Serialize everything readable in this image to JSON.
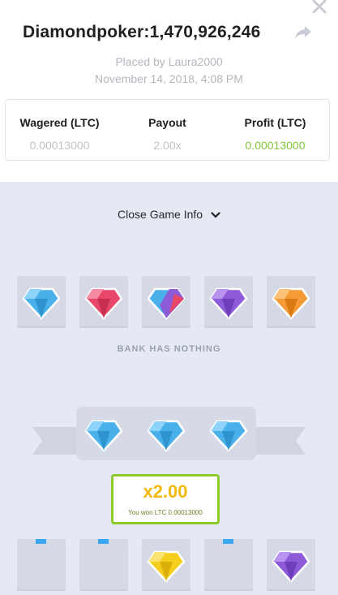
{
  "header": {
    "title": "Diamondpoker:1,470,926,246",
    "placed_by": "Placed by Laura2000",
    "placed_at": "November 14, 2018, 4:08 PM",
    "icons": [
      "close-icon",
      "share-icon"
    ]
  },
  "stats": {
    "wagered_label": "Wagered (LTC)",
    "wagered_value": "0.00013000",
    "payout_label": "Payout",
    "payout_value": "2.00x",
    "profit_label": "Profit (LTC)",
    "profit_value": "0.00013000",
    "profit_color": "#86c440"
  },
  "game": {
    "toggle_label": "Close Game Info",
    "bank_message": "BANK HAS NOTHING",
    "bank_gems": [
      "blue",
      "red",
      "blue-purple",
      "purple",
      "orange"
    ],
    "player_gems": [
      "blue",
      "blue",
      "blue"
    ],
    "result": {
      "multiplier": "x2.00",
      "won_text": "You won LTC 0.00013000"
    },
    "bottom_slots": [
      "empty",
      "empty",
      "yellow",
      "empty",
      "purple"
    ],
    "colors": {
      "blue": "#4ab0ea",
      "red": "#e9476a",
      "purple": "#8d5bd8",
      "orange": "#f49b35",
      "yellow": "#f6cf1e",
      "accent_green": "#8ecb2a",
      "multiplier_gold": "#f2b90c"
    }
  }
}
